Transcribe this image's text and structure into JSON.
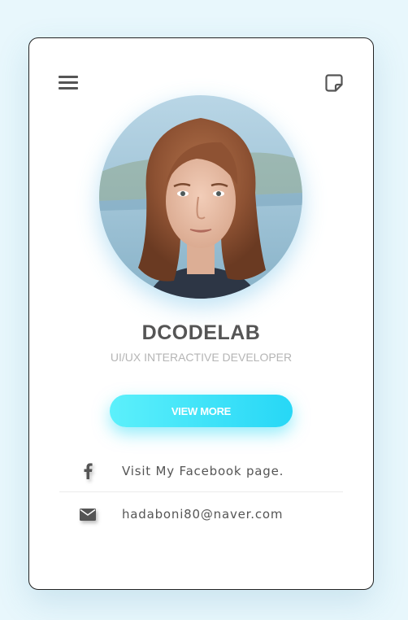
{
  "profile": {
    "name": "DCODELAB",
    "title": "UI/UX INTERACTIVE DEVELOPER"
  },
  "actions": {
    "view_more_label": "VIEW MORE"
  },
  "contacts": [
    {
      "icon": "facebook-icon",
      "label": "Visit My Facebook page."
    },
    {
      "icon": "envelope-icon",
      "label": "hadaboni80@naver.com"
    }
  ],
  "colors": {
    "page_background": "#e8f7fc",
    "accent": "#27d7f6",
    "text": "#555555",
    "subtitle": "#b5b5b5"
  },
  "icons": {
    "menu": "hamburger-menu-icon",
    "top_right": "sticky-note-icon"
  }
}
